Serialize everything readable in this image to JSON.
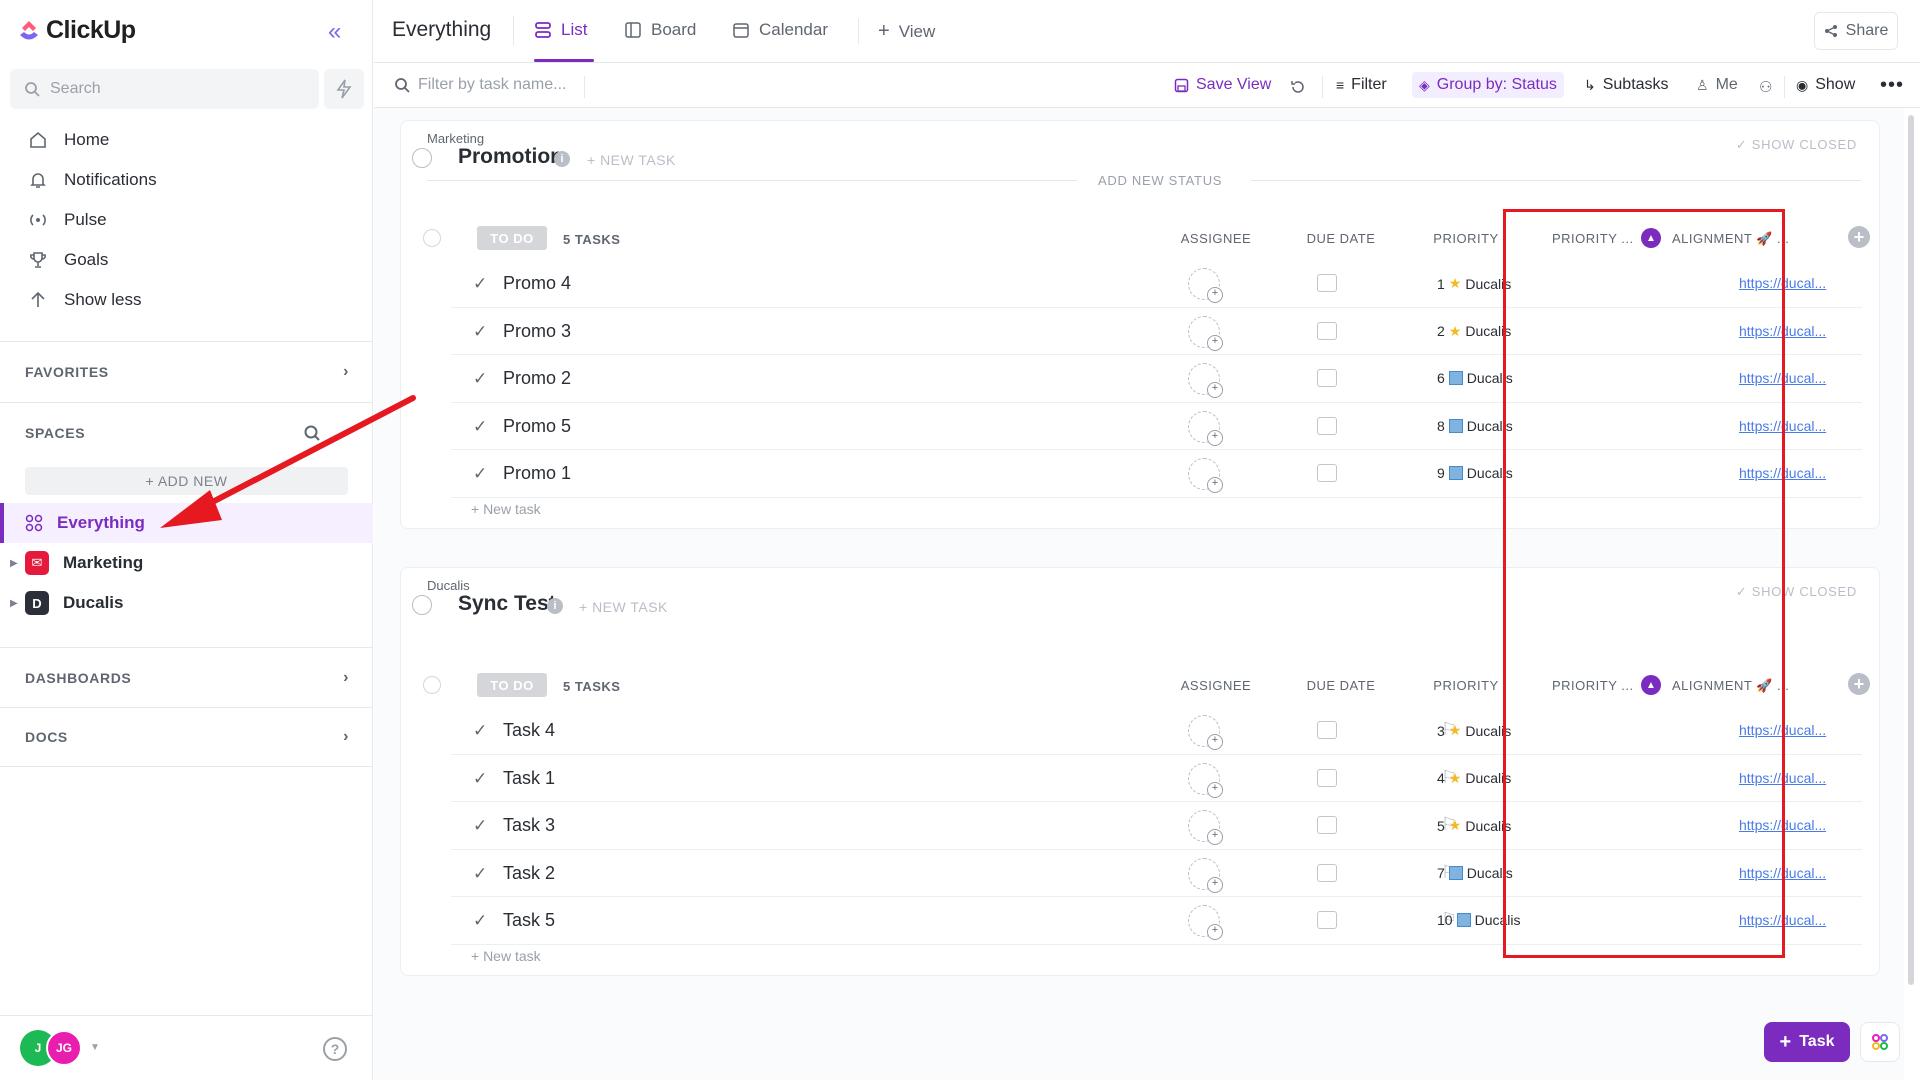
{
  "app": {
    "name": "ClickUp"
  },
  "sidebar": {
    "search_placeholder": "Search",
    "nav": [
      {
        "label": "Home",
        "icon": "home-icon"
      },
      {
        "label": "Notifications",
        "icon": "bell-icon"
      },
      {
        "label": "Pulse",
        "icon": "pulse-icon"
      },
      {
        "label": "Goals",
        "icon": "trophy-icon"
      },
      {
        "label": "Show less",
        "icon": "arrow-up-icon"
      }
    ],
    "favorites_label": "FAVORITES",
    "spaces_label": "SPACES",
    "add_new_label": "+ ADD NEW",
    "spaces": [
      {
        "label": "Everything",
        "icon": "grid-icon",
        "color": "#7b2cbf"
      },
      {
        "label": "Marketing",
        "icon": "mail-icon",
        "color": "#e5193c"
      },
      {
        "label": "Ducalis",
        "icon": "D",
        "color": "#2b2f3a"
      }
    ],
    "dashboards_label": "DASHBOARDS",
    "docs_label": "DOCS",
    "avatars": [
      {
        "initials": "J",
        "color": "#1db954"
      },
      {
        "initials": "JG",
        "color": "#e91eaf"
      }
    ]
  },
  "header": {
    "title": "Everything",
    "tabs": [
      {
        "label": "List",
        "active": true
      },
      {
        "label": "Board"
      },
      {
        "label": "Calendar"
      },
      {
        "label": "View"
      }
    ],
    "share_label": "Share"
  },
  "toolbar": {
    "filter_placeholder": "Filter by task name...",
    "save_view": "Save View",
    "filter": "Filter",
    "group_by": "Group by: Status",
    "subtasks": "Subtasks",
    "me": "Me",
    "show": "Show"
  },
  "columns": {
    "assignee": "ASSIGNEE",
    "due_date": "DUE DATE",
    "priority": "PRIORITY",
    "priority_score": "PRIORITY ...",
    "alignment": "ALIGNMENT 🚀 ..."
  },
  "lists": [
    {
      "space": "Marketing",
      "title": "Promotion",
      "new_task": "+ NEW TASK",
      "show_closed": "✓ SHOW CLOSED",
      "add_status": "ADD NEW STATUS",
      "status": "TO DO",
      "count": "5 TASKS",
      "new_task_row": "+ New task",
      "show_priority_flag": false,
      "tasks": [
        {
          "name": "Promo 4",
          "score": "1",
          "badge": "star",
          "source": "Ducalis",
          "link": "https://ducal..."
        },
        {
          "name": "Promo 3",
          "score": "2",
          "badge": "star",
          "source": "Ducalis",
          "link": "https://ducal..."
        },
        {
          "name": "Promo 2",
          "score": "6",
          "badge": "square",
          "source": "Ducalis",
          "link": "https://ducal..."
        },
        {
          "name": "Promo 5",
          "score": "8",
          "badge": "square",
          "source": "Ducalis",
          "link": "https://ducal..."
        },
        {
          "name": "Promo 1",
          "score": "9",
          "badge": "square",
          "source": "Ducalis",
          "link": "https://ducal..."
        }
      ]
    },
    {
      "space": "Ducalis",
      "title": "Sync Test",
      "new_task": "+ NEW TASK",
      "show_closed": "✓ SHOW CLOSED",
      "status": "TO DO",
      "count": "5 TASKS",
      "new_task_row": "+ New task",
      "show_priority_flag": true,
      "tasks": [
        {
          "name": "Task 4",
          "score": "3",
          "badge": "star",
          "source": "Ducalis",
          "link": "https://ducal..."
        },
        {
          "name": "Task 1",
          "score": "4",
          "badge": "star",
          "source": "Ducalis",
          "link": "https://ducal..."
        },
        {
          "name": "Task 3",
          "score": "5",
          "badge": "star",
          "source": "Ducalis",
          "link": "https://ducal..."
        },
        {
          "name": "Task 2",
          "score": "7",
          "badge": "square",
          "source": "Ducalis",
          "link": "https://ducal..."
        },
        {
          "name": "Task 5",
          "score": "10",
          "badge": "square",
          "source": "Ducalis",
          "link": "https://ducal..."
        }
      ]
    }
  ],
  "fab": {
    "label": "Task"
  },
  "colors": {
    "accent": "#7b2cbf",
    "highlight": "#e5191f"
  }
}
